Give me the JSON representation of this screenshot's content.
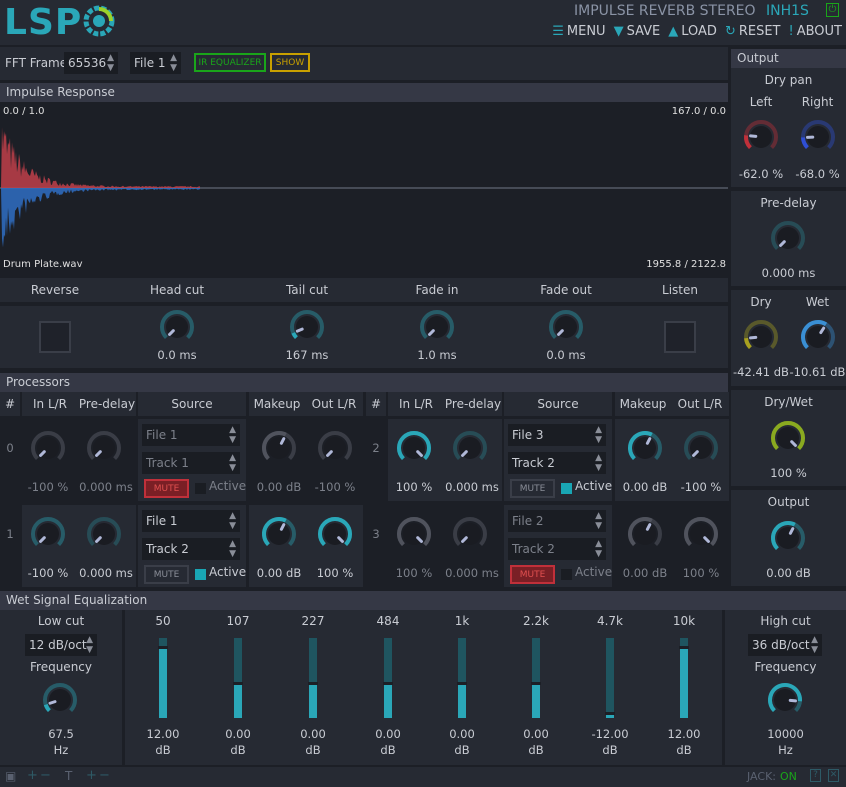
{
  "header": {
    "logo": "LSP",
    "title": "IMPULSE REVERB STEREO",
    "instance": "INH1S",
    "menu": [
      {
        "icon": "menu-icon",
        "glyph": "☰",
        "label": "MENU"
      },
      {
        "icon": "save-icon",
        "glyph": "▼",
        "label": "SAVE"
      },
      {
        "icon": "load-icon",
        "glyph": "▲",
        "label": "LOAD"
      },
      {
        "icon": "reset-icon",
        "glyph": "↻",
        "label": "RESET"
      },
      {
        "icon": "about-icon",
        "glyph": "!",
        "label": "ABOUT"
      }
    ]
  },
  "toolbar": {
    "fft_label": "FFT Frame",
    "fft_value": "65536",
    "file_value": "File 1",
    "ir_eq": "IR EQUALIZER",
    "show": "SHOW"
  },
  "ir": {
    "title": "Impulse Response",
    "tl": "0.0 / 1.0",
    "tr": "167.0 / 0.0",
    "bl": "Drum Plate.wav",
    "br": "1955.8 / 2122.8",
    "colors": {
      "left": "#c0404a",
      "right": "#2f6fc4"
    }
  },
  "ir_controls": [
    {
      "label": "Reverse",
      "type": "check"
    },
    {
      "label": "Head cut",
      "value": "0.0 ms",
      "knob": 0.0
    },
    {
      "label": "Tail cut",
      "value": "167 ms",
      "knob": 0.08
    },
    {
      "label": "Fade in",
      "value": "1.0 ms",
      "knob": 0.0
    },
    {
      "label": "Fade out",
      "value": "0.0 ms",
      "knob": 0.0
    },
    {
      "label": "Listen",
      "type": "check"
    }
  ],
  "processors": {
    "title": "Processors",
    "columns": [
      "#",
      "In L/R",
      "Pre-delay",
      "Source",
      "Makeup",
      "Out L/R"
    ],
    "items": [
      {
        "num": "0",
        "in": "-100 %",
        "in_k": 0,
        "pre": "0.000 ms",
        "pre_k": 0,
        "file": "File 1",
        "track": "Track 1",
        "mute": true,
        "active": false,
        "makeup": "0.00 dB",
        "makeup_k": 0.6,
        "out": "-100 %",
        "out_k": 0,
        "enabled": false
      },
      {
        "num": "1",
        "in": "-100 %",
        "in_k": 0,
        "pre": "0.000 ms",
        "pre_k": 0,
        "file": "File 1",
        "track": "Track 2",
        "mute": false,
        "active": true,
        "makeup": "0.00 dB",
        "makeup_k": 0.6,
        "out": "100 %",
        "out_k": 1,
        "enabled": true
      },
      {
        "num": "2",
        "in": "100 %",
        "in_k": 1,
        "pre": "0.000 ms",
        "pre_k": 0,
        "file": "File 3",
        "track": "Track 2",
        "mute": false,
        "active": true,
        "makeup": "0.00 dB",
        "makeup_k": 0.6,
        "out": "-100 %",
        "out_k": 0,
        "enabled": true
      },
      {
        "num": "3",
        "in": "100 %",
        "in_k": 1,
        "pre": "0.000 ms",
        "pre_k": 0,
        "file": "File 2",
        "track": "Track 2",
        "mute": true,
        "active": false,
        "makeup": "0.00 dB",
        "makeup_k": 0.6,
        "out": "100 %",
        "out_k": 1,
        "enabled": false
      }
    ],
    "mute_label": "MUTE",
    "active_label": "Active"
  },
  "output": {
    "title": "Output",
    "dry_pan": "Dry pan",
    "left": "Left",
    "right": "Right",
    "left_value": "-62.0 %",
    "left_k": 0.19,
    "right_value": "-68.0 %",
    "right_k": 0.16,
    "predelay": "Pre-delay",
    "predelay_value": "0.000 ms",
    "predelay_k": 0,
    "dry": "Dry",
    "wet": "Wet",
    "dry_value": "-42.41 dB",
    "dry_k": 0.15,
    "wet_value": "-10.61 dB",
    "wet_k": 0.62,
    "drywet": "Dry/Wet",
    "drywet_value": "100 %",
    "drywet_k": 1,
    "output": "Output",
    "output_value": "0.00 dB",
    "output_k": 0.6
  },
  "eq": {
    "title": "Wet Signal Equalization",
    "low_cut": "Low cut",
    "low_slope": "12 dB/oct",
    "frequency": "Frequency",
    "low_freq": "67.5",
    "low_k": 0.1,
    "hz": "Hz",
    "high_cut": "High cut",
    "high_slope": "36 dB/oct",
    "high_freq": "10000",
    "high_k": 0.85,
    "unit": "dB",
    "bands": [
      {
        "f": "50",
        "g": "12.00",
        "v": 12
      },
      {
        "f": "107",
        "g": "0.00",
        "v": 0
      },
      {
        "f": "227",
        "g": "0.00",
        "v": 0
      },
      {
        "f": "484",
        "g": "0.00",
        "v": 0
      },
      {
        "f": "1k",
        "g": "0.00",
        "v": 0
      },
      {
        "f": "2.2k",
        "g": "0.00",
        "v": 0
      },
      {
        "f": "4.7k",
        "g": "-12.00",
        "v": -12
      },
      {
        "f": "10k",
        "g": "12.00",
        "v": 12
      }
    ]
  },
  "footer": {
    "jack": "JACK:",
    "jack_status": "ON"
  },
  "colors": {
    "accent": "#2aa7b8",
    "bg": "#1c1f26",
    "panel": "#262a33",
    "mute": "#c0303a",
    "ireq": "#1aa51a",
    "show": "#c8a000"
  }
}
